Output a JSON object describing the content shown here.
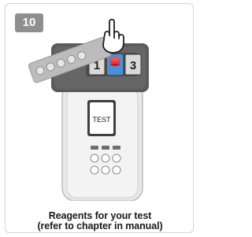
{
  "step": {
    "number": "10"
  },
  "device": {
    "screen_text": "TEST",
    "slot_left_label": "1",
    "slot_right_label": "3"
  },
  "caption": {
    "line1": "Reagents for your test",
    "line2": "(refer to chapter in manual)"
  },
  "colors": {
    "badge_bg": "#8f8f8f",
    "device_dark": "#555555",
    "device_body": "#e6e6e6",
    "accent_blue": "#4a90d9",
    "tablet_red": "#e53935",
    "blister_strip": "#b9b9b9"
  },
  "icons": {
    "hand": "pointing-hand-icon",
    "tablet": "red-tablet-icon",
    "blister": "tablet-blister-strip-icon"
  }
}
